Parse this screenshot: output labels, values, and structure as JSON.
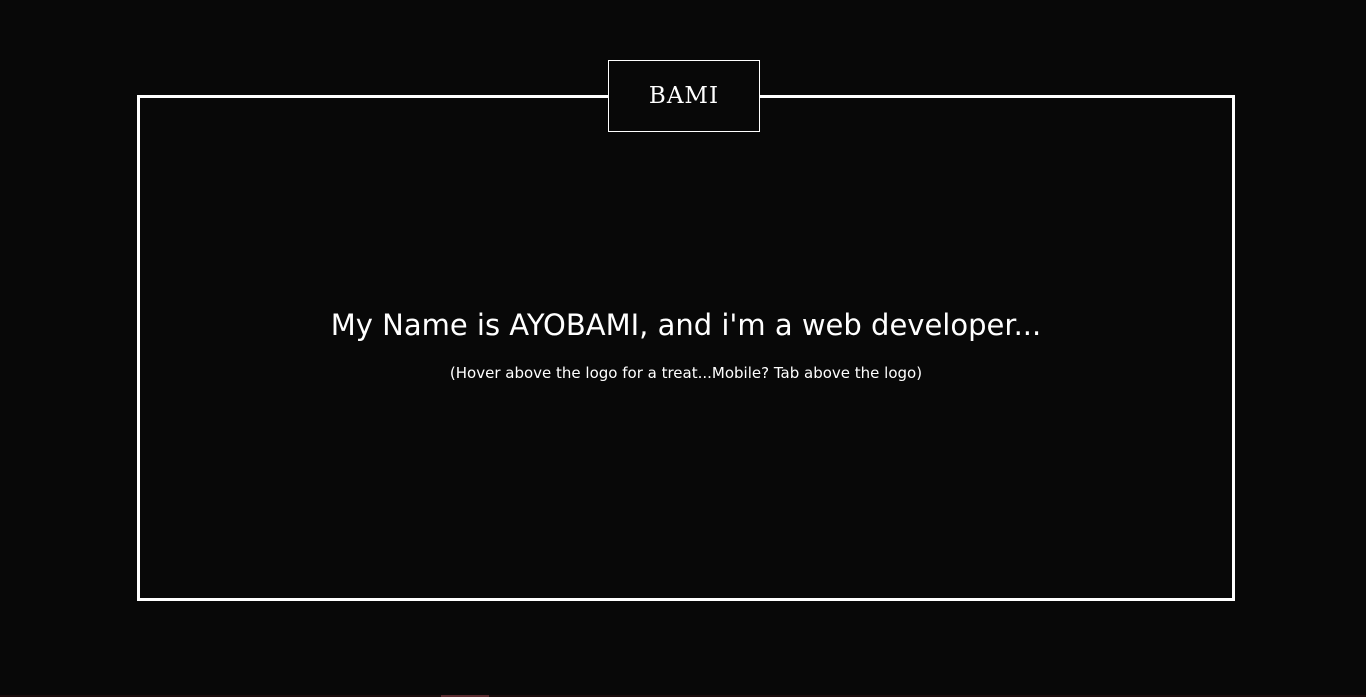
{
  "logo": {
    "text": "BAMI"
  },
  "hero": {
    "headline": "My Name is AYOBAMI, and i'm a web developer...",
    "subline": "(Hover above the logo for a treat...Mobile? Tab above the logo)"
  },
  "colors": {
    "background": "#080808",
    "foreground": "#ffffff",
    "accent": "#5a2a2e"
  }
}
